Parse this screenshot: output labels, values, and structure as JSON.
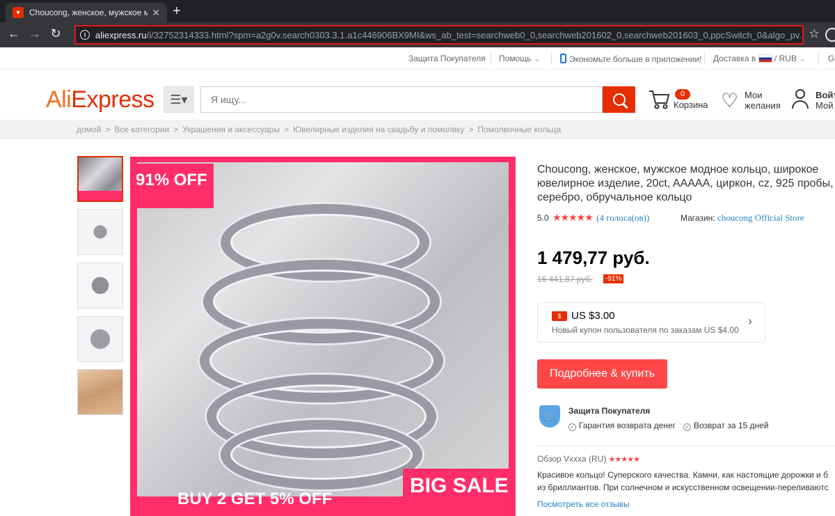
{
  "browser": {
    "tab_title": "Choucong, женское, мужское м",
    "tab_close": "✕",
    "new_tab": "+",
    "url_host": "aliexpress.ru",
    "url_path": "/i/32752314333.html?spm=a2g0v.search0303.3.1.a1c446906BX9MI&ws_ab_test=searchweb0_0,searchweb201602_0,searchweb201603_0,ppcSwitch_0&algo_pv..."
  },
  "toplinks": {
    "protection": "Защита Покупателя",
    "help": "Помощь",
    "app": "Экономьте больше в приложении!",
    "delivery": "Доставка в",
    "currency": "RUB",
    "lang": "G"
  },
  "header": {
    "logo_a": "Ali",
    "logo_b": "Express",
    "search_placeholder": "Я ищу...",
    "cart_count": "0",
    "cart_label": "Корзина",
    "wish_line1": "Мои",
    "wish_line2": "желания",
    "user_line1": "Войт",
    "user_line2": "Мой"
  },
  "breadcrumbs": [
    "домой",
    "Все категории",
    "Украшения и аксессуары",
    "Ювелирные изделия на свадьбу и помолвку",
    "Помолвочные кольца"
  ],
  "image": {
    "badge_off": "91% OFF",
    "big_sale": "BIG SALE",
    "buy2": "BUY 2 GET 5% OFF"
  },
  "product": {
    "title": "Choucong, женское, мужское модное кольцо, широкое ювелирное изделие, 20ct, AAAAA, циркон, cz, 925 пробы, серебро, обручальное кольцо",
    "rating_value": "5.0",
    "stars": "★★★★★",
    "votes": "(4 голоса(ов))",
    "shop_label": "Магазин:",
    "shop_name": "choucong Official Store",
    "price": "1 479,77 руб.",
    "old_price": "16 441,87 руб.",
    "discount": "-91%"
  },
  "coupon": {
    "amount": "US $3.00",
    "subtitle": "Новый купон пользователя по заказам US $4.00"
  },
  "buy_button": "Подробнее & купить",
  "protection": {
    "title": "Защита Покупателя",
    "g1": "Гарантия возврата денег",
    "g2": "Возврат за 15 дней"
  },
  "review": {
    "head": "Обзор Vxxxa (RU)",
    "stars": "★★★★★",
    "line1": "Красивое кольцо! Суперского качества. Камни, как настоящие дорожки и б",
    "line2": "из бриллиантов. При солнечном и искусственном освещении-переливаютс",
    "link": "Посмотреть все отзывы"
  }
}
